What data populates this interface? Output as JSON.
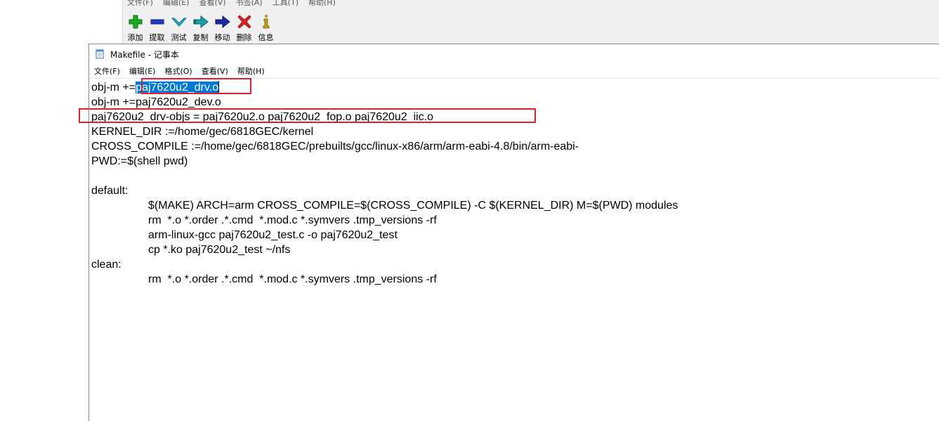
{
  "background_app": {
    "menu": [
      "文件(F)",
      "编辑(E)",
      "查看(V)",
      "书签(A)",
      "工具(T)",
      "帮助(H)"
    ],
    "toolbar": [
      {
        "label": "添加",
        "icon": "add-icon"
      },
      {
        "label": "提取",
        "icon": "extract-icon"
      },
      {
        "label": "测试",
        "icon": "test-icon"
      },
      {
        "label": "复制",
        "icon": "copy-icon"
      },
      {
        "label": "移动",
        "icon": "move-icon"
      },
      {
        "label": "删除",
        "icon": "delete-icon"
      },
      {
        "label": "信息",
        "icon": "info-icon"
      }
    ]
  },
  "notepad": {
    "title": "Makefile - 记事本",
    "menu": [
      "文件(F)",
      "编辑(E)",
      "格式(O)",
      "查看(V)",
      "帮助(H)"
    ],
    "lines": {
      "l1_prefix": "obj-m +=",
      "l1_selected": "paj7620u2_drv.o",
      "l2": "obj-m +=paj7620u2_dev.o",
      "l3": "paj7620u2_drv-objs = paj7620u2.o paj7620u2_fop.o paj7620u2_iic.o",
      "l4": "KERNEL_DIR :=/home/gec/6818GEC/kernel",
      "l5": "CROSS_COMPILE :=/home/gec/6818GEC/prebuilts/gcc/linux-x86/arm/arm-eabi-4.8/bin/arm-eabi-",
      "l6": "PWD:=$(shell pwd)",
      "l7": "",
      "l8": "default:",
      "l9": "$(MAKE) ARCH=arm CROSS_COMPILE=$(CROSS_COMPILE) -C $(KERNEL_DIR) M=$(PWD) modules",
      "l10": "rm  *.o *.order .*.cmd  *.mod.c *.symvers .tmp_versions -rf",
      "l11": "arm-linux-gcc paj7620u2_test.c -o paj7620u2_test",
      "l12": "cp *.ko paj7620u2_test ~/nfs",
      "l13": "clean:",
      "l14": "rm  *.o *.order .*.cmd  *.mod.c *.symvers .tmp_versions -rf"
    }
  },
  "colors": {
    "selection": "#0078d7",
    "annotation": "#e01f2f"
  }
}
